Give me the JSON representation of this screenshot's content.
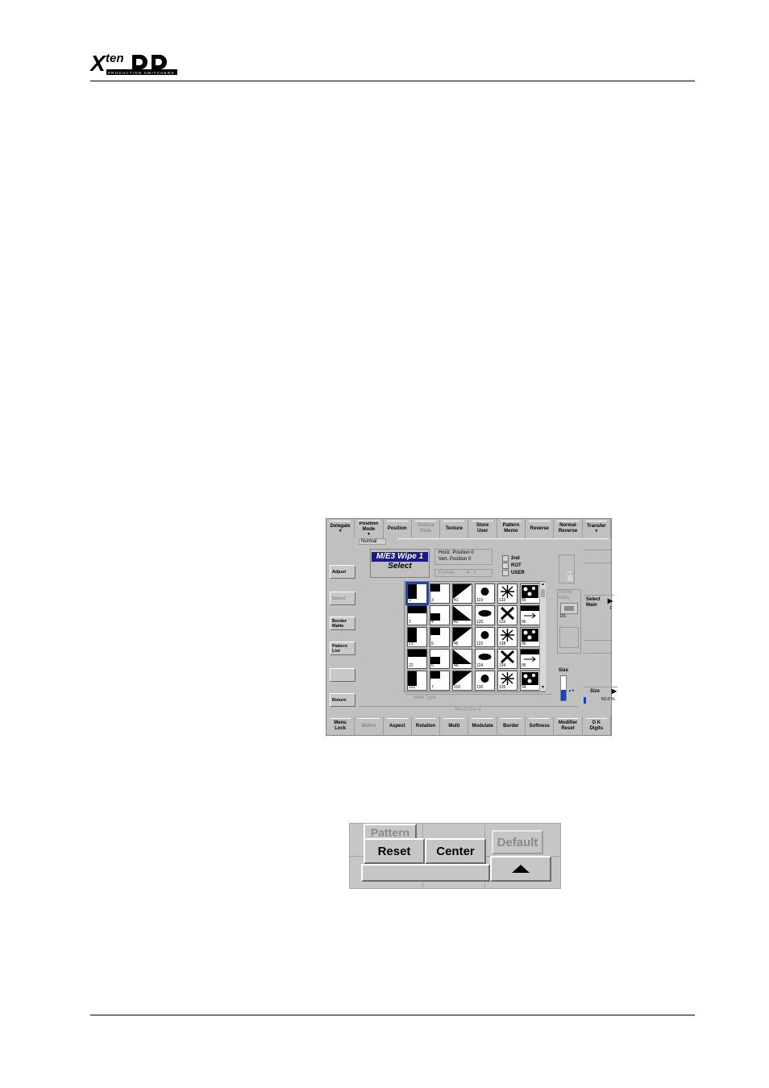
{
  "header": {
    "logo_text": "Xten DD",
    "logo_subtitle": "PRODUCTION SWITCHERS"
  },
  "panel": {
    "top_bar": [
      {
        "label": "Delegate",
        "arrow": true,
        "dim": false
      },
      {
        "label": "Position Mode",
        "arrow": true,
        "dim": false
      },
      {
        "label": "Position",
        "arrow": false,
        "dim": false
      },
      {
        "label": "Texture Grab",
        "arrow": false,
        "dim": true
      },
      {
        "label": "Texture",
        "arrow": false,
        "dim": false
      },
      {
        "label": "Store User",
        "arrow": false,
        "dim": false
      },
      {
        "label": "Pattern Memo",
        "arrow": false,
        "dim": false
      },
      {
        "label": "Reverse",
        "arrow": false,
        "dim": false
      },
      {
        "label": "Normal Reverse",
        "arrow": false,
        "dim": false
      },
      {
        "label": "Transfer",
        "arrow": true,
        "dim": false
      }
    ],
    "position_mode_value": "Normal",
    "left_buttons": [
      {
        "label": "Adjust",
        "dim": false
      },
      {
        "label": "Select",
        "dim": true
      },
      {
        "label": "Border Matte",
        "dim": false
      },
      {
        "label": "Pattern List",
        "dim": false
      },
      {
        "label": "",
        "dim": false
      },
      {
        "label": "Return",
        "dim": false
      }
    ],
    "title": "M/E3 Wipe 1",
    "subtitle": "Select",
    "horiz_position": "Horiz. Position 0",
    "vert_position": "Vert.  Position 0",
    "format_label": "Format",
    "format_value": "4 : 3",
    "checkboxes": [
      "2nd",
      "ROT",
      "USER"
    ],
    "patterns": [
      [
        "1",
        "3",
        "41",
        "119",
        "132",
        "85"
      ],
      [
        "2",
        "4",
        "42",
        "120",
        "133",
        "86"
      ],
      [
        "21",
        "5",
        "45",
        "122",
        "138",
        "90"
      ],
      [
        "22",
        "6",
        "46",
        "124",
        "134",
        "95"
      ],
      [
        "101",
        "7",
        "102",
        "130",
        "135",
        "94"
      ]
    ],
    "mate_type_label": "Mate Type",
    "modifiers_label": "Modifiers",
    "active_main_label": "Active Main",
    "active_main_value": "101",
    "size_label": "Size",
    "size_level": 0.45,
    "select_main_label": "Select Main",
    "select_main_value": "1",
    "size_right_label": "Size",
    "size_right_value": "50.0 %",
    "bottom_bar": [
      {
        "label": "Menu Lock",
        "dim": false
      },
      {
        "label": "Matrix",
        "dim": true
      },
      {
        "label": "Aspect",
        "dim": false
      },
      {
        "label": "Rotation",
        "dim": false
      },
      {
        "label": "Multi",
        "dim": false
      },
      {
        "label": "Modulate",
        "dim": false
      },
      {
        "label": "Border",
        "dim": false
      },
      {
        "label": "Softness",
        "dim": false
      },
      {
        "label": "Modifier Reset",
        "dim": false
      },
      {
        "label": "O K Digits",
        "dim": false
      }
    ]
  },
  "fragment": {
    "pattern_label": "Pattern",
    "reset_label": "Reset",
    "center_label": "Center",
    "default_label": "Default",
    "up_arrow_icon": "triangle-up-icon"
  },
  "colors": {
    "panel_bg": "#c0c0c0",
    "title_bg": "#1a1a8c",
    "select_outline": "#1a3fc4",
    "size_fill": "#1a3fc4"
  }
}
